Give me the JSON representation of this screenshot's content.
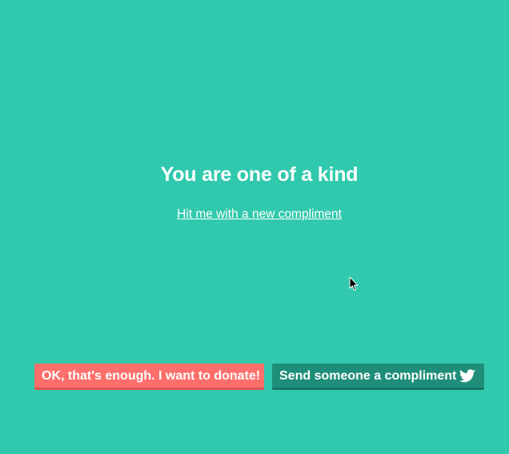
{
  "main": {
    "compliment": "You are one of a kind",
    "new_compliment_link": "Hit me with a new compliment"
  },
  "footer": {
    "donate_button": "OK, that's enough. I want to donate!",
    "share_button": "Send someone a compliment",
    "share_icon": "twitter-bird-icon"
  },
  "cursor": {
    "icon": "mouse-pointer-icon"
  },
  "colors": {
    "background": "#31c9ad",
    "donate": "#fd6f6b",
    "share": "#1f8e79",
    "text": "#ffffff"
  }
}
